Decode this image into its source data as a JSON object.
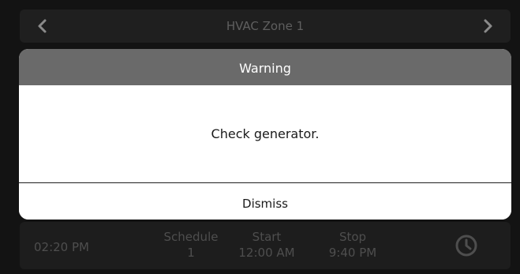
{
  "nav": {
    "title": "HVAC Zone 1",
    "prev_icon": "chevron-left-icon",
    "next_icon": "chevron-right-icon"
  },
  "modal": {
    "title": "Warning",
    "message": "Check generator.",
    "dismiss_label": "Dismiss"
  },
  "status_bar": {
    "time": "02:20 PM",
    "schedule_label": "Schedule",
    "schedule_value": "1",
    "start_label": "Start",
    "start_value": "12:00 AM",
    "stop_label": "Stop",
    "stop_value": "9:40 PM",
    "clock_icon": "clock-icon"
  },
  "colors": {
    "background": "#131313",
    "modal_header": "#6a6a6a",
    "modal_body": "#ffffff",
    "dimmed_text": "#4e4e4e"
  }
}
